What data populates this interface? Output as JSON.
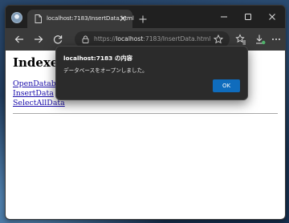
{
  "browser": {
    "tab_title": "localhost:7183/InsertData.html",
    "url_scheme": "https://",
    "url_host": "localhost",
    "url_rest": ":7183/InsertData.html"
  },
  "page": {
    "title": "Indexe",
    "links": [
      {
        "label": "OpenDatab"
      },
      {
        "label": "InsertData"
      },
      {
        "label": "SelectAllData"
      }
    ]
  },
  "dialog": {
    "title": "localhost:7183 の内容",
    "message": "データベースをオープンしました。",
    "ok_label": "OK"
  },
  "colors": {
    "accent": "#0f6cbd",
    "link": "#1a0dab",
    "chrome_dark": "#202020",
    "toolbar": "#3a3a3a"
  }
}
